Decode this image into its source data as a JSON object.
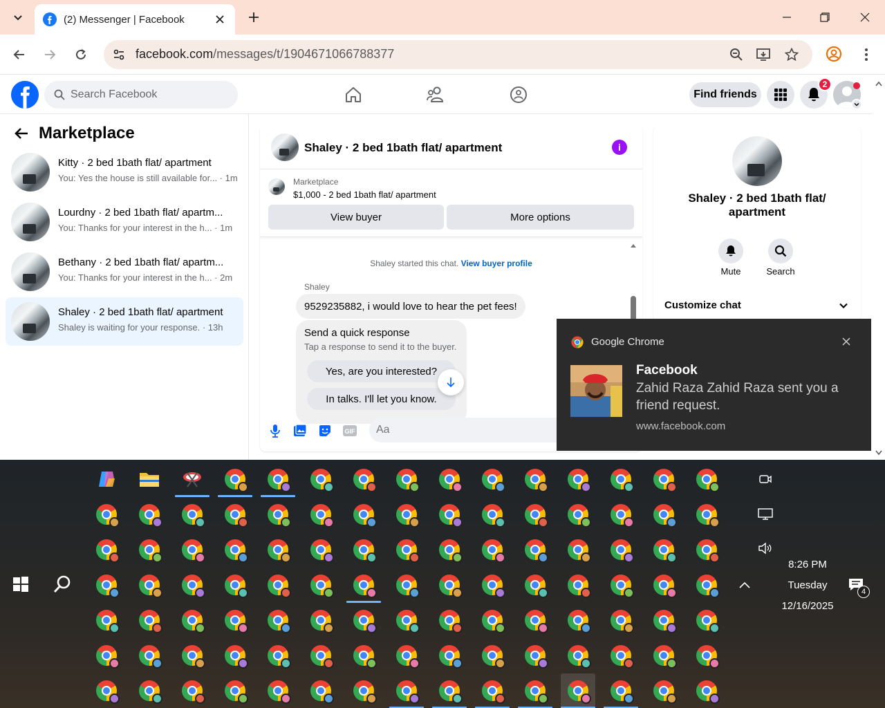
{
  "browser": {
    "tab_title": "(2) Messenger | Facebook",
    "url_host": "facebook.com",
    "url_path": "/messages/t/1904671066788377"
  },
  "fb": {
    "search_placeholder": "Search Facebook",
    "find_friends": "Find friends",
    "notif_count": "2"
  },
  "left": {
    "title": "Marketplace",
    "conversations": [
      {
        "name": "Kitty · 2 bed 1bath flat/ apartment",
        "snippet": "You: Yes the house is still available for... · 1m"
      },
      {
        "name": "Lourdny · 2 bed 1bath flat/ apartm...",
        "snippet": "You: Thanks for your interest in the h... · 1m"
      },
      {
        "name": "Bethany · 2 bed 1bath flat/ apartm...",
        "snippet": "You: Thanks for your interest in the h... · 2m"
      },
      {
        "name": "Shaley · 2 bed 1bath flat/ apartment",
        "snippet": "Shaley is waiting for your response. · 13h"
      }
    ]
  },
  "chat": {
    "title": "Shaley · 2 bed 1bath flat/ apartment",
    "listing_category": "Marketplace",
    "listing_price": "$1,000 - 2 bed 1bath flat/ apartment",
    "view_buyer": "View buyer",
    "more_options": "More options",
    "started_text": "Shaley started this chat.",
    "view_buyer_profile": "View buyer profile",
    "sender": "Shaley",
    "message": "9529235882, i would love to hear the pet fees!",
    "quick_title": "Send a quick response",
    "quick_subtitle": "Tap a response to send it to the buyer.",
    "quick_1": "Yes, are you interested?",
    "quick_2": "In talks. I'll let you know.",
    "composer_placeholder": "Aa"
  },
  "info": {
    "name": "Shaley · 2 bed 1bath flat/ apartment",
    "mute": "Mute",
    "search": "Search",
    "customize": "Customize chat"
  },
  "notification": {
    "app": "Google Chrome",
    "title": "Facebook",
    "body": "Zahid Raza Zahid Raza sent you a friend request.",
    "site": "www.facebook.com"
  },
  "clock": {
    "time": "8:26 PM",
    "day": "Tuesday",
    "date": "12/16/2025",
    "notifications": "4"
  },
  "colors": {
    "fb_blue": "#0866ff",
    "messenger_purple": "#9b10f5",
    "badge_red": "#e41e3f",
    "active_chat": "#ebf5ff"
  }
}
